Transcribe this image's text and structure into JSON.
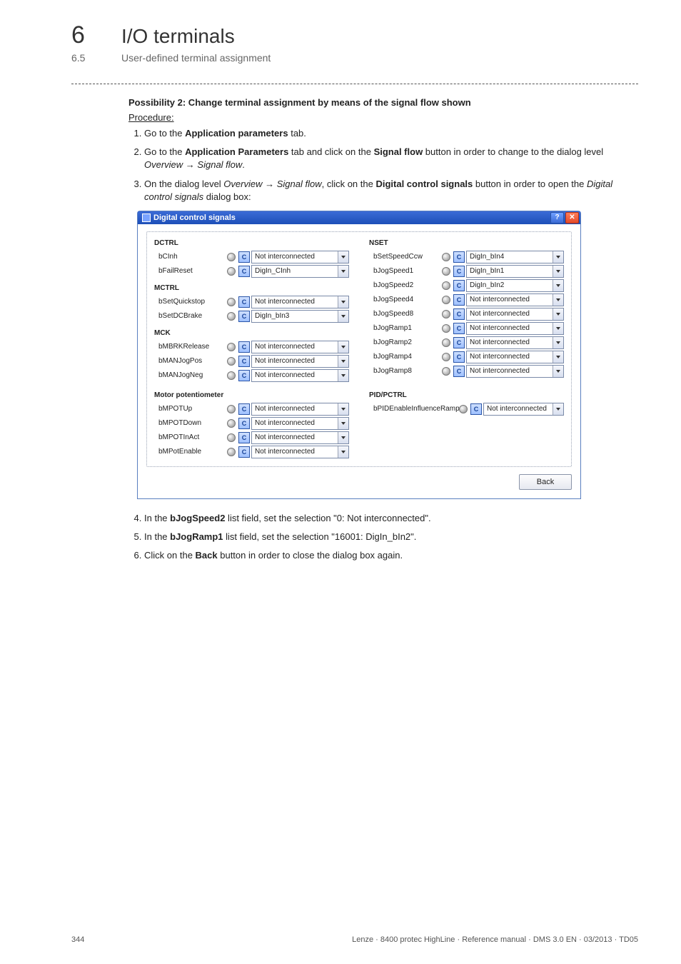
{
  "header": {
    "chapter_num": "6",
    "chapter_title": "I/O terminals",
    "section_num": "6.5",
    "section_title": "User-defined terminal assignment"
  },
  "body": {
    "possibility_heading": "Possibility 2: Change terminal assignment by means of the signal flow shown",
    "procedure_label": "Procedure:",
    "step1_a": "Go to the ",
    "step1_b": "Application parameters",
    "step1_c": " tab.",
    "step2_a": "Go to the ",
    "step2_b": "Application Parameters",
    "step2_c": " tab and click on the ",
    "step2_d": "Signal flow",
    "step2_e": " button in order to change to the dialog level ",
    "step2_f": "Overview",
    "step2_g": "Signal flow",
    "step2_h": ".",
    "step3_a": "On the dialog level ",
    "step3_b": "Overview",
    "step3_c": "Signal flow",
    "step3_d": ", click on the ",
    "step3_e": "Digital control signals",
    "step3_f": " button in order to open the ",
    "step3_g": "Digital control signals",
    "step3_h": " dialog box:",
    "step4_a": "In the ",
    "step4_b": "bJogSpeed2",
    "step4_c": " list field, set the selection \"0: Not interconnected\".",
    "step5_a": "In the ",
    "step5_b": "bJogRamp1",
    "step5_c": " list field, set the selection \"16001: DigIn_bIn2\".",
    "step6_a": "Click on the ",
    "step6_b": "Back",
    "step6_c": " button in order to close the dialog box again."
  },
  "dialog": {
    "title": "Digital control signals",
    "help_glyph": "?",
    "close_glyph": "✕",
    "c_label": "C",
    "back_label": "Back",
    "groups": {
      "dctrl": {
        "head": "DCTRL",
        "bCInh": {
          "label": "bCInh",
          "value": "Not interconnected"
        },
        "bFailReset": {
          "label": "bFailReset",
          "value": "DigIn_CInh"
        }
      },
      "mctrl": {
        "head": "MCTRL",
        "bSetQuickstop": {
          "label": "bSetQuickstop",
          "value": "Not interconnected"
        },
        "bSetDCBrake": {
          "label": "bSetDCBrake",
          "value": "DigIn_bIn3"
        }
      },
      "mck": {
        "head": "MCK",
        "bMBRKRelease": {
          "label": "bMBRKRelease",
          "value": "Not interconnected"
        },
        "bMANJogPos": {
          "label": "bMANJogPos",
          "value": "Not interconnected"
        },
        "bMANJogNeg": {
          "label": "bMANJogNeg",
          "value": "Not interconnected"
        }
      },
      "motorpot": {
        "head": "Motor potentiometer",
        "bMPOTUp": {
          "label": "bMPOTUp",
          "value": "Not interconnected"
        },
        "bMPOTDown": {
          "label": "bMPOTDown",
          "value": "Not interconnected"
        },
        "bMPOTInAct": {
          "label": "bMPOTInAct",
          "value": "Not interconnected"
        },
        "bMPotEnable": {
          "label": "bMPotEnable",
          "value": "Not interconnected"
        }
      },
      "nset": {
        "head": "NSET",
        "bSetSpeedCcw": {
          "label": "bSetSpeedCcw",
          "value": "DigIn_bIn4"
        },
        "bJogSpeed1": {
          "label": "bJogSpeed1",
          "value": "DigIn_bIn1"
        },
        "bJogSpeed2": {
          "label": "bJogSpeed2",
          "value": "DigIn_bIn2"
        },
        "bJogSpeed4": {
          "label": "bJogSpeed4",
          "value": "Not interconnected"
        },
        "bJogSpeed8": {
          "label": "bJogSpeed8",
          "value": "Not interconnected"
        },
        "bJogRamp1": {
          "label": "bJogRamp1",
          "value": "Not interconnected"
        },
        "bJogRamp2": {
          "label": "bJogRamp2",
          "value": "Not interconnected"
        },
        "bJogRamp4": {
          "label": "bJogRamp4",
          "value": "Not interconnected"
        },
        "bJogRamp8": {
          "label": "bJogRamp8",
          "value": "Not interconnected"
        }
      },
      "pid": {
        "head": "PID/PCTRL",
        "bPIDEnableInfluenceRamp": {
          "label": "bPIDEnableInfluenceRamp",
          "value": "Not interconnected"
        }
      }
    }
  },
  "footer": {
    "page_num": "344",
    "doc_info": "Lenze · 8400 protec HighLine · Reference manual · DMS 3.0 EN · 03/2013 · TD05"
  }
}
